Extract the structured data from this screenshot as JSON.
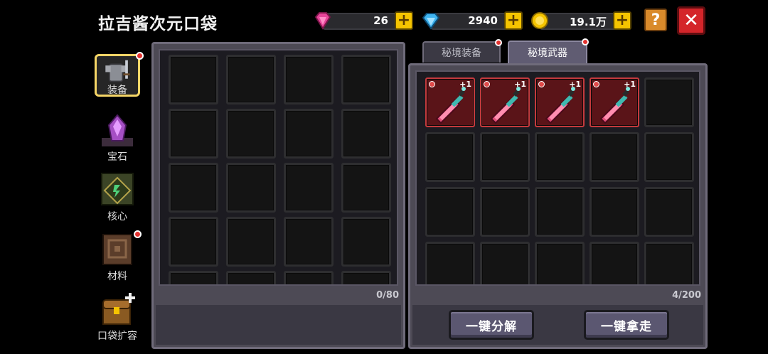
{
  "header": {
    "title": "拉吉酱次元口袋"
  },
  "currencies": [
    {
      "name": "pink-gem",
      "value": "26",
      "color": "#e8459a"
    },
    {
      "name": "blue-diamond",
      "value": "2940",
      "color": "#3fb4f0"
    },
    {
      "name": "gold-coin",
      "value": "19.1万",
      "color": "#f5c400"
    }
  ],
  "buttons": {
    "plus": "+",
    "help": "?",
    "close": "✕"
  },
  "sidebar": {
    "items": [
      {
        "label": "装备",
        "active": true,
        "badge": true
      },
      {
        "label": "宝石",
        "active": false,
        "badge": false
      },
      {
        "label": "核心",
        "active": false,
        "badge": false
      },
      {
        "label": "材料",
        "active": false,
        "badge": true
      },
      {
        "label": "口袋扩容",
        "active": false,
        "badge": false
      }
    ]
  },
  "left_panel": {
    "count": "0/80"
  },
  "right_panel": {
    "tabs": [
      {
        "label": "秘境装备",
        "active": false,
        "badge": true
      },
      {
        "label": "秘境武器",
        "active": true,
        "badge": true
      }
    ],
    "count": "4/200",
    "item_level": "+1",
    "actions": {
      "decompose": "一键分解",
      "take_all": "一键拿走"
    }
  }
}
